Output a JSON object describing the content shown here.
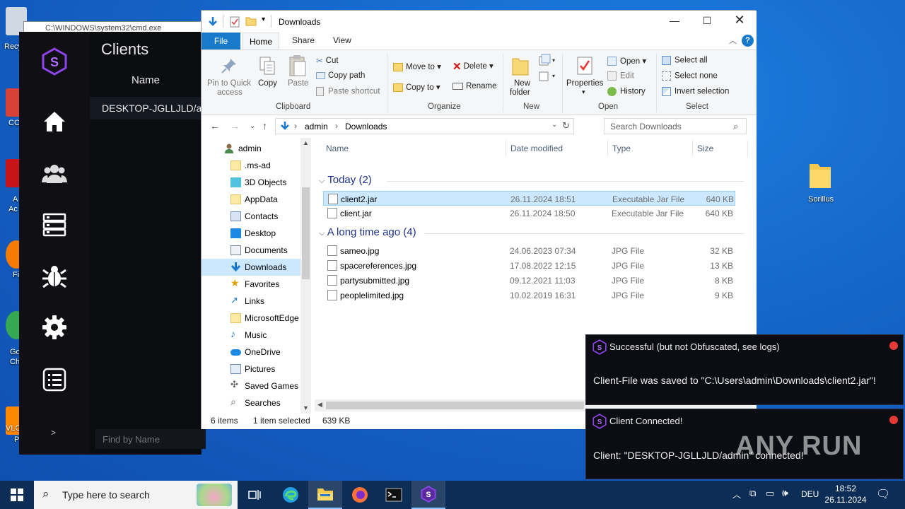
{
  "desktop": {
    "left_labels": [
      "Recy",
      "CC",
      "A",
      "Ac",
      "Fi",
      "Go",
      "Ch",
      "VLC",
      "P"
    ],
    "folder_label": "Sorillus"
  },
  "cmd_window": {
    "title": "C:\\WINDOWS\\system32\\cmd.exe"
  },
  "client_app": {
    "title": "Clients",
    "column_header": "Name",
    "rows": [
      "DESKTOP-JGLLJLD/a..."
    ],
    "find_placeholder": "Find by Name",
    "nav_icons": [
      "logo-icon",
      "home-icon",
      "users-icon",
      "servers-icon",
      "bug-icon",
      "gear-icon",
      "list-icon"
    ],
    "expand_label": ">"
  },
  "explorer": {
    "title": "Downloads",
    "tabs": {
      "file": "File",
      "home": "Home",
      "share": "Share",
      "view": "View"
    },
    "ribbon": {
      "pin": "Pin to Quick access",
      "pin_line1": "Pin to Quick",
      "pin_line2": "access",
      "copy": "Copy",
      "paste": "Paste",
      "cut": "Cut",
      "copy_path": "Copy path",
      "paste_shortcut": "Paste shortcut",
      "clipboard_group": "Clipboard",
      "move_to": "Move to",
      "copy_to": "Copy to",
      "delete": "Delete",
      "rename": "Rename",
      "organize_group": "Organize",
      "new_folder_1": "New",
      "new_folder_2": "folder",
      "new_group": "New",
      "properties": "Properties",
      "open": "Open",
      "edit": "Edit",
      "history": "History",
      "open_group": "Open",
      "select_all": "Select all",
      "select_none": "Select none",
      "invert_selection": "Invert selection",
      "select_group": "Select"
    },
    "address": {
      "crumb1": "admin",
      "crumb2": "Downloads"
    },
    "search_placeholder": "Search Downloads",
    "nav_items": [
      {
        "label": "admin",
        "icon": "user-icon"
      },
      {
        "label": ".ms-ad",
        "icon": "folder-icon"
      },
      {
        "label": "3D Objects",
        "icon": "3d-objects-icon"
      },
      {
        "label": "AppData",
        "icon": "folder-icon"
      },
      {
        "label": "Contacts",
        "icon": "contacts-icon"
      },
      {
        "label": "Desktop",
        "icon": "desktop-icon"
      },
      {
        "label": "Documents",
        "icon": "documents-icon"
      },
      {
        "label": "Downloads",
        "icon": "downloads-icon"
      },
      {
        "label": "Favorites",
        "icon": "star-icon"
      },
      {
        "label": "Links",
        "icon": "links-icon"
      },
      {
        "label": "MicrosoftEdge",
        "icon": "folder-icon"
      },
      {
        "label": "Music",
        "icon": "music-icon"
      },
      {
        "label": "OneDrive",
        "icon": "onedrive-icon"
      },
      {
        "label": "Pictures",
        "icon": "pictures-icon"
      },
      {
        "label": "Saved Games",
        "icon": "games-icon"
      },
      {
        "label": "Searches",
        "icon": "search-icon"
      }
    ],
    "columns": {
      "name": "Name",
      "date": "Date modified",
      "type": "Type",
      "size": "Size"
    },
    "groups": [
      {
        "label": "Today (2)",
        "files": [
          {
            "name": "client2.jar",
            "date": "26.11.2024 18:51",
            "type": "Executable Jar File",
            "size": "640 KB",
            "selected": true
          },
          {
            "name": "client.jar",
            "date": "26.11.2024 18:50",
            "type": "Executable Jar File",
            "size": "640 KB",
            "selected": false
          }
        ]
      },
      {
        "label": "A long time ago (4)",
        "files": [
          {
            "name": "sameo.jpg",
            "date": "24.06.2023 07:34",
            "type": "JPG File",
            "size": "32 KB",
            "selected": false
          },
          {
            "name": "spacereferences.jpg",
            "date": "17.08.2022 12:15",
            "type": "JPG File",
            "size": "13 KB",
            "selected": false
          },
          {
            "name": "partysubmitted.jpg",
            "date": "09.12.2021 11:03",
            "type": "JPG File",
            "size": "8 KB",
            "selected": false
          },
          {
            "name": "peoplelimited.jpg",
            "date": "10.02.2019 16:31",
            "type": "JPG File",
            "size": "9 KB",
            "selected": false
          }
        ]
      }
    ],
    "status": {
      "items": "6 items",
      "selected": "1 item selected",
      "size": "639 KB"
    }
  },
  "toasts": [
    {
      "title": "Successful (but not Obfuscated, see logs)",
      "message": "Client-File was saved to \"C:\\Users\\admin\\Downloads\\client2.jar\"!"
    },
    {
      "title": "Client Connected!",
      "message": "Client: \"DESKTOP-JGLLJLD/admin\" connected!"
    }
  ],
  "watermark": "ANY RUN",
  "taskbar": {
    "search_placeholder": "Type here to search",
    "language": "DEU",
    "time": "18:52",
    "date": "26.11.2024"
  },
  "colors": {
    "accent": "#1979ca",
    "selection": "#cce8ff",
    "app_purple": "#8e44ec",
    "toast_dot": "#e53935"
  }
}
